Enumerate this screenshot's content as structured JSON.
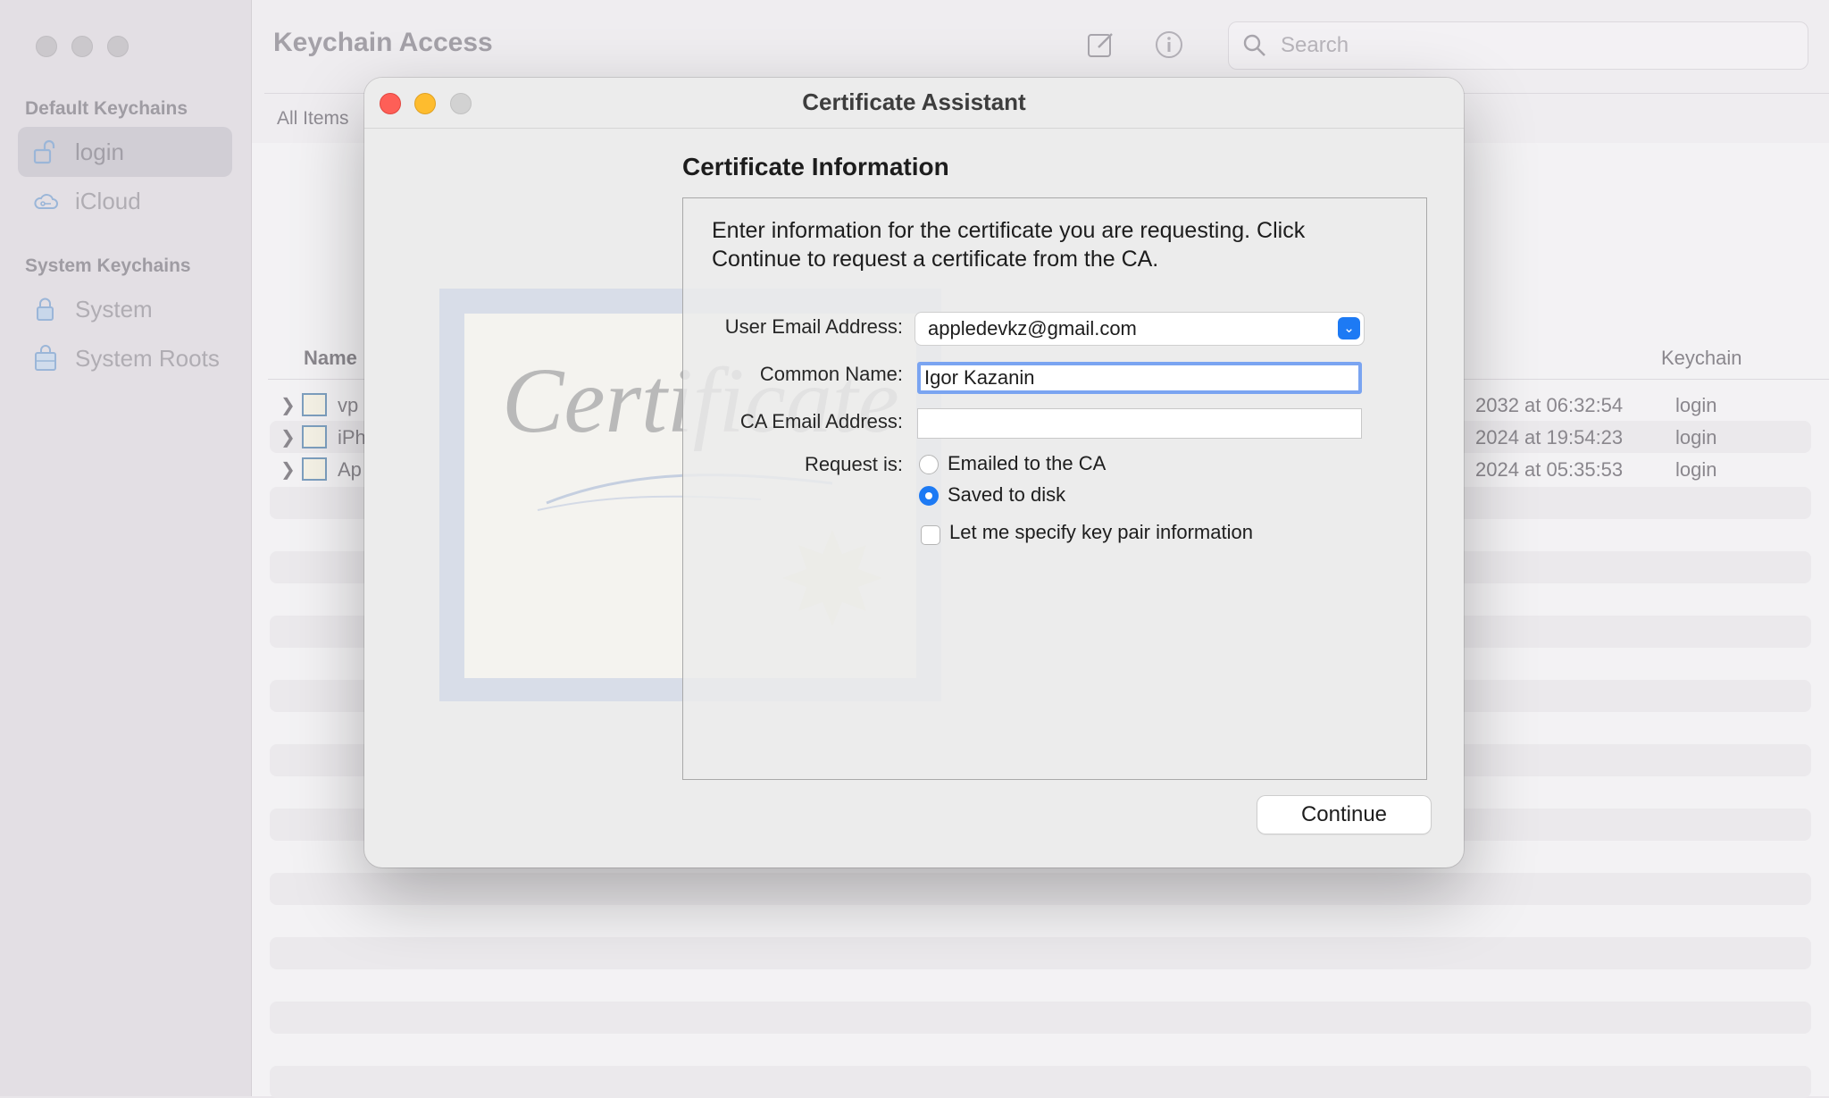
{
  "app": {
    "title": "Keychain Access"
  },
  "search": {
    "placeholder": "Search"
  },
  "sidebar": {
    "default_header": "Default Keychains",
    "system_header": "System Keychains",
    "items": [
      {
        "label": "login",
        "icon": "unlocked-padlock-icon",
        "selected": true
      },
      {
        "label": "iCloud",
        "icon": "cloud-icon",
        "selected": false
      },
      {
        "label": "System",
        "icon": "padlock-icon",
        "selected": false
      },
      {
        "label": "System Roots",
        "icon": "locked-cabinet-icon",
        "selected": false
      }
    ]
  },
  "tabs": {
    "all_items": "All Items"
  },
  "table": {
    "columns": {
      "name": "Name",
      "keychain": "Keychain"
    },
    "rows": [
      {
        "name": "vp",
        "date": "2032 at 06:32:54",
        "keychain": "login"
      },
      {
        "name": "iPh",
        "date": "2024 at 19:54:23",
        "keychain": "login"
      },
      {
        "name": "Ap",
        "date": "2024 at 05:35:53",
        "keychain": "login"
      }
    ]
  },
  "dialog": {
    "title": "Certificate Assistant",
    "section_title": "Certificate Information",
    "intro": "Enter information for the certificate you are requesting. Click Continue to request a certificate from the CA.",
    "certificate_art_text": "Certificate",
    "fields": {
      "user_email_label": "User Email Address:",
      "user_email_value": "appledevkz@gmail.com",
      "common_name_label": "Common Name:",
      "common_name_value": "Igor Kazanin",
      "ca_email_label": "CA Email Address:",
      "ca_email_value": "",
      "request_label": "Request is:"
    },
    "request_options": [
      {
        "label": "Emailed to the CA",
        "selected": false
      },
      {
        "label": "Saved to disk",
        "selected": true
      }
    ],
    "keypair_label": "Let me specify key pair information",
    "keypair_checked": false,
    "continue_label": "Continue"
  },
  "colors": {
    "accent": "#1d7af4",
    "close": "#fe5f57",
    "minimize": "#febc2e",
    "focus_ring": "#7aa4f1"
  }
}
